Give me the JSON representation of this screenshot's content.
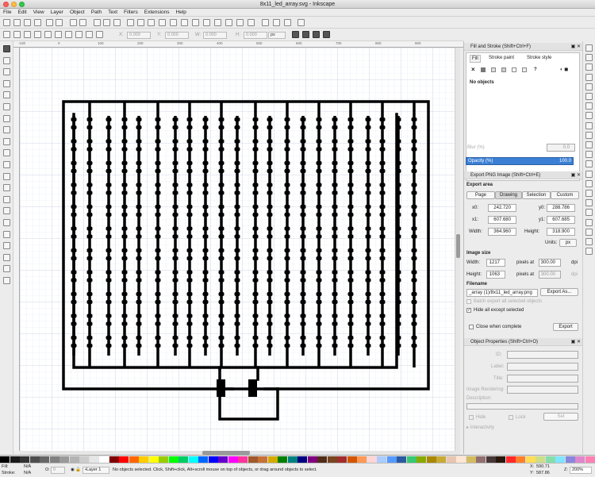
{
  "window": {
    "title": "8x11_led_array.svg - Inkscape"
  },
  "menu": [
    "File",
    "Edit",
    "View",
    "Layer",
    "Object",
    "Path",
    "Text",
    "Filters",
    "Extensions",
    "Help"
  ],
  "controls": {
    "x_label": "X:",
    "x_value": "0.000",
    "y_label": "Y:",
    "y_value": "0.000",
    "w_label": "W:",
    "w_value": "0.000",
    "h_label": "H:",
    "h_value": "0.000",
    "units": "px"
  },
  "ruler_top_labels": [
    "-100",
    "0",
    "100",
    "200",
    "300",
    "400",
    "500",
    "600",
    "700",
    "800",
    "900"
  ],
  "fill_stroke": {
    "title": "Fill and Stroke (Shift+Ctrl+F)",
    "tabs": [
      "Fill",
      "Stroke paint",
      "Stroke style"
    ],
    "message": "No objects",
    "blur_label": "Blur (%)",
    "blur_value": "0.0",
    "opacity_label": "Opacity (%)",
    "opacity_value": "100.0"
  },
  "export_png": {
    "title": "Export PNG Image (Shift+Ctrl+E)",
    "area_heading": "Export area",
    "area_tabs": [
      "Page",
      "Drawing",
      "Selection",
      "Custom"
    ],
    "x0_label": "x0:",
    "x0": "242.720",
    "y0_label": "y0:",
    "y0": "288.786",
    "x1_label": "x1:",
    "x1": "607.680",
    "y1_label": "y1:",
    "y1": "607.685",
    "width_label": "Width:",
    "width": "364.960",
    "height_label": "Height:",
    "height": "318.900",
    "units_label": "Units:",
    "units": "px",
    "size_heading": "Image size",
    "img_width_label": "Width:",
    "img_width": "1217",
    "img_height_label": "Height:",
    "img_height": "1063",
    "pixels_at": "pixels at",
    "dpi_value": "300.00",
    "dpi_value2": "300.00",
    "dpi": "dpi",
    "filename_heading": "Filename",
    "filename": "_array (1)/8x11_led_array.png",
    "export_as": "Export As...",
    "batch_label": "Batch export all selected objects",
    "hide_label": "Hide all except selected",
    "close_label": "Close when complete",
    "export_button": "Export"
  },
  "object_properties": {
    "title": "Object Properties (Shift+Ctrl+O)",
    "id_label": "ID:",
    "label_label": "Label:",
    "title_label": "Title:",
    "rendering_label": "Image Rendering:",
    "description_label": "Description:",
    "hide_label": "Hide",
    "lock_label": "Lock",
    "set_button": "Set",
    "interactivity_label": "Interactivity"
  },
  "status": {
    "fill_label": "Fill:",
    "fill_value": "N/A",
    "stroke_label": "Stroke:",
    "stroke_value": "N/A",
    "opacity_label": "O:",
    "opacity_value": "0",
    "layer": "•Layer 1",
    "message": "No objects selected. Click, Shift+click, Alt+scroll mouse on top of objects, or drag around objects to select.",
    "x_label": "X:",
    "x_value": "590.71",
    "y_label": "Y:",
    "y_value": "587.86",
    "z_label": "Z:",
    "zoom": "200%"
  },
  "palette": [
    "#000000",
    "#1a1a1a",
    "#333333",
    "#4d4d4d",
    "#666666",
    "#808080",
    "#999999",
    "#b3b3b3",
    "#cccccc",
    "#e6e6e6",
    "#ffffff",
    "#800000",
    "#ff0000",
    "#ff6600",
    "#ffcc00",
    "#ffff00",
    "#99cc00",
    "#00ff00",
    "#00cc66",
    "#00ffff",
    "#0066ff",
    "#0000ff",
    "#6600cc",
    "#ff00ff",
    "#ff3399",
    "#a05a2c",
    "#c87137",
    "#d4aa00",
    "#008000",
    "#008080",
    "#000080",
    "#800080",
    "#502d16",
    "#784421",
    "#a02c2c",
    "#d45500",
    "#ff9955",
    "#ffd5d5",
    "#aaccff",
    "#5599ff",
    "#2c5aa0",
    "#37c871",
    "#88aa00",
    "#aa8800",
    "#c8ab37",
    "#e9c6af",
    "#ffe6d5",
    "#d3bc5f",
    "#916f6f",
    "#483737",
    "#28170b",
    "#ff2a2a",
    "#ff7f2a",
    "#ffdd55",
    "#cdde87",
    "#87deaa",
    "#80e5ff",
    "#8787de",
    "#de87cd",
    "#ff80b2"
  ]
}
